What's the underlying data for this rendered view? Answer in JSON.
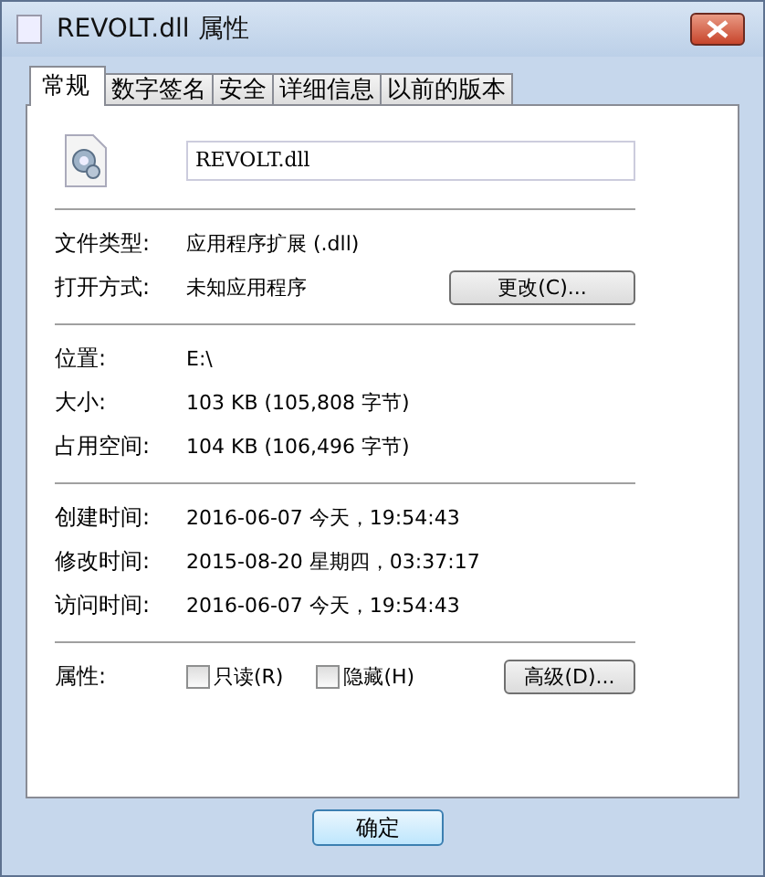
{
  "window": {
    "title": "REVOLT.dll 属性"
  },
  "tabs": [
    {
      "label": "常规",
      "selected": true
    },
    {
      "label": "数字签名",
      "selected": false
    },
    {
      "label": "安全",
      "selected": false
    },
    {
      "label": "详细信息",
      "selected": false
    },
    {
      "label": "以前的版本",
      "selected": false
    }
  ],
  "file_name": {
    "value": "REVOLT.dll"
  },
  "groups": [
    [
      {
        "label": "文件类型:",
        "value": "应用程序扩展 (.dll)"
      },
      {
        "label": "打开方式:",
        "value": "未知应用程序",
        "button": "更改(C)..."
      }
    ],
    [
      {
        "label": "位置:",
        "value": "E:\\"
      },
      {
        "label": "大小:",
        "value": "103 KB (105,808 字节)"
      },
      {
        "label": "占用空间:",
        "value": "104 KB (106,496 字节)"
      }
    ],
    [
      {
        "label": "创建时间:",
        "value": "2016-06-07 今天，19:54:43"
      },
      {
        "label": "修改时间:",
        "value": "2015-08-20 星期四，03:37:17"
      },
      {
        "label": "访问时间:",
        "value": "2016-06-07 今天，19:54:43"
      }
    ]
  ],
  "attributes": {
    "label": "属性:",
    "options": [
      {
        "label": "只读(R)",
        "checked": false
      },
      {
        "label": "隐藏(H)",
        "checked": false
      }
    ],
    "button": "高级(D)..."
  },
  "buttons": [
    "确定"
  ]
}
